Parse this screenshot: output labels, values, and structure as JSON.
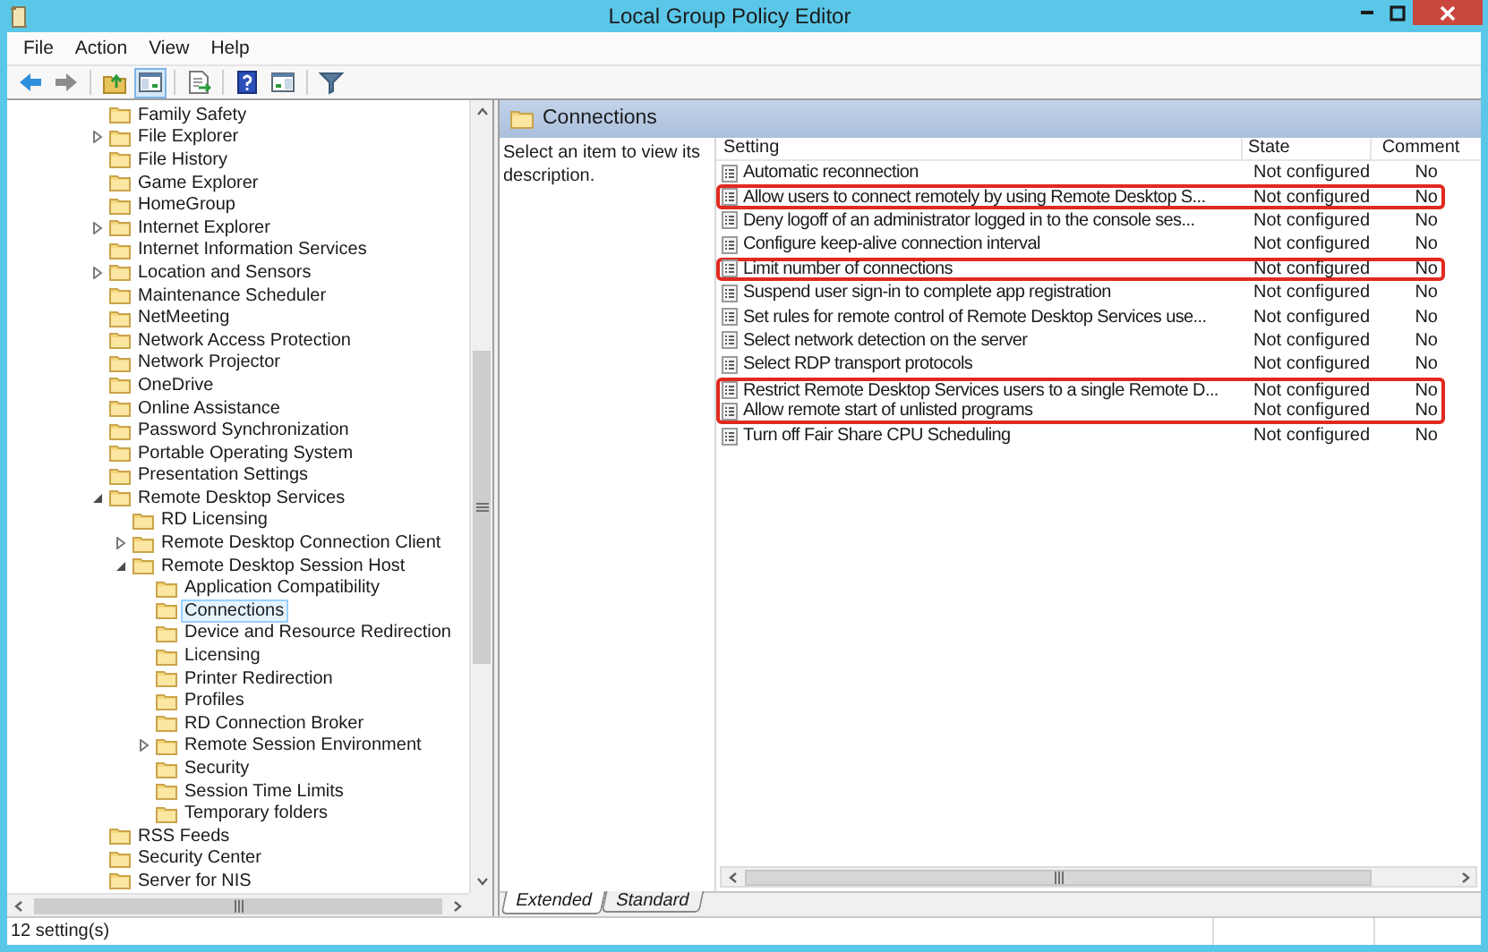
{
  "window": {
    "title": "Local Group Policy Editor"
  },
  "menu": [
    "File",
    "Action",
    "View",
    "Help"
  ],
  "toolbar": [
    {
      "kind": "back",
      "pressed": false
    },
    {
      "kind": "forward",
      "pressed": false
    },
    {
      "kind": "separator"
    },
    {
      "kind": "up",
      "pressed": false
    },
    {
      "kind": "tree",
      "pressed": true
    },
    {
      "kind": "separator"
    },
    {
      "kind": "export",
      "pressed": false
    },
    {
      "kind": "separator"
    },
    {
      "kind": "help",
      "pressed": false
    },
    {
      "kind": "pane",
      "pressed": false
    },
    {
      "kind": "separator"
    },
    {
      "kind": "filter",
      "pressed": false
    }
  ],
  "tree": {
    "items": [
      {
        "label": "Family Safety",
        "selected": false
      },
      {
        "label": "File Explorer",
        "expanded": false,
        "selected": false
      },
      {
        "label": "File History",
        "selected": false
      },
      {
        "label": "Game Explorer",
        "selected": false
      },
      {
        "label": "HomeGroup",
        "selected": false
      },
      {
        "label": "Internet Explorer",
        "expanded": false,
        "selected": false
      },
      {
        "label": "Internet Information Services",
        "selected": false
      },
      {
        "label": "Location and Sensors",
        "expanded": false,
        "selected": false
      },
      {
        "label": "Maintenance Scheduler",
        "selected": false
      },
      {
        "label": "NetMeeting",
        "selected": false
      },
      {
        "label": "Network Access Protection",
        "selected": false
      },
      {
        "label": "Network Projector",
        "selected": false
      },
      {
        "label": "OneDrive",
        "selected": false
      },
      {
        "label": "Online Assistance",
        "selected": false
      },
      {
        "label": "Password Synchronization",
        "selected": false
      },
      {
        "label": "Portable Operating System",
        "selected": false
      },
      {
        "label": "Presentation Settings",
        "selected": false
      },
      {
        "label": "Remote Desktop Services",
        "expanded": true,
        "selected": false,
        "children": [
          {
            "label": "RD Licensing",
            "selected": false
          },
          {
            "label": "Remote Desktop Connection Client",
            "expanded": false,
            "selected": false
          },
          {
            "label": "Remote Desktop Session Host",
            "expanded": true,
            "selected": false,
            "children": [
              {
                "label": "Application Compatibility",
                "selected": false
              },
              {
                "label": "Connections",
                "selected": true
              },
              {
                "label": "Device and Resource Redirection",
                "selected": false
              },
              {
                "label": "Licensing",
                "selected": false
              },
              {
                "label": "Printer Redirection",
                "selected": false
              },
              {
                "label": "Profiles",
                "selected": false
              },
              {
                "label": "RD Connection Broker",
                "selected": false
              },
              {
                "label": "Remote Session Environment",
                "expanded": false,
                "selected": false
              },
              {
                "label": "Security",
                "selected": false
              },
              {
                "label": "Session Time Limits",
                "selected": false
              },
              {
                "label": "Temporary folders",
                "selected": false
              }
            ]
          }
        ]
      },
      {
        "label": "RSS Feeds",
        "selected": false
      },
      {
        "label": "Security Center",
        "selected": false
      },
      {
        "label": "Server for NIS",
        "selected": false
      }
    ]
  },
  "details": {
    "title": "Connections",
    "description": "Select an item to view its description.",
    "columns": [
      "Setting",
      "State",
      "Comment"
    ],
    "rows": [
      {
        "setting": "Automatic reconnection",
        "state": "Not configured",
        "comment": "No",
        "highlighted": false
      },
      {
        "setting": "Allow users to connect remotely by using Remote Desktop S...",
        "state": "Not configured",
        "comment": "No",
        "highlighted": true
      },
      {
        "setting": "Deny logoff of an administrator logged in to the console ses...",
        "state": "Not configured",
        "comment": "No",
        "highlighted": false
      },
      {
        "setting": "Configure keep-alive connection interval",
        "state": "Not configured",
        "comment": "No",
        "highlighted": false
      },
      {
        "setting": "Limit number of connections",
        "state": "Not configured",
        "comment": "No",
        "highlighted": true
      },
      {
        "setting": "Suspend user sign-in to complete app registration",
        "state": "Not configured",
        "comment": "No",
        "highlighted": false
      },
      {
        "setting": "Set rules for remote control of Remote Desktop Services use...",
        "state": "Not configured",
        "comment": "No",
        "highlighted": false
      },
      {
        "setting": "Select network detection on the server",
        "state": "Not configured",
        "comment": "No",
        "highlighted": false
      },
      {
        "setting": "Select RDP transport protocols",
        "state": "Not configured",
        "comment": "No",
        "highlighted": false
      },
      {
        "setting": "Restrict Remote Desktop Services users to a single Remote D...",
        "state": "Not configured",
        "comment": "No",
        "highlighted": true
      },
      {
        "setting": "Allow remote start of unlisted programs",
        "state": "Not configured",
        "comment": "No",
        "highlighted": true
      },
      {
        "setting": "Turn off Fair Share CPU Scheduling",
        "state": "Not configured",
        "comment": "No",
        "highlighted": false
      }
    ],
    "tabs": [
      {
        "label": "Extended",
        "selected": true
      },
      {
        "label": "Standard",
        "selected": false
      }
    ]
  },
  "status_bar": "12 setting(s)"
}
